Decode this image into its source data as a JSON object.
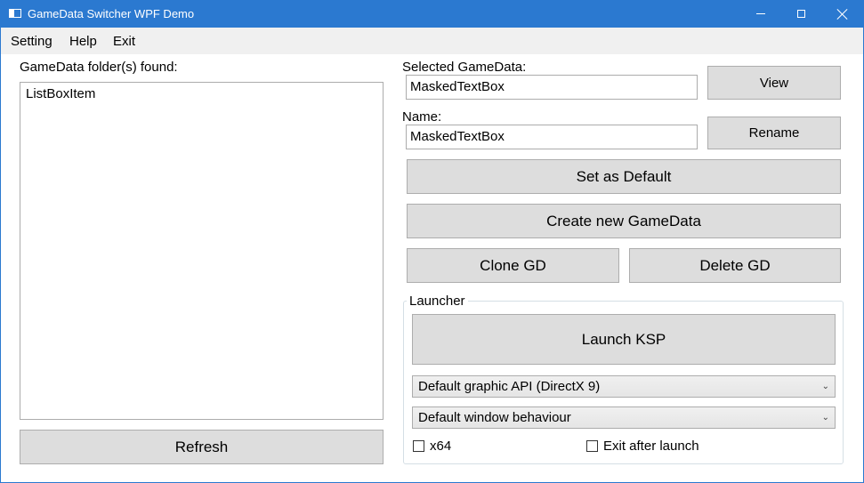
{
  "window": {
    "title": "GameData Switcher WPF Demo"
  },
  "menu": {
    "items": [
      "Setting",
      "Help",
      "Exit"
    ]
  },
  "left": {
    "folders_label": "GameData folder(s) found:",
    "list_items": [
      "ListBoxItem"
    ],
    "refresh_label": "Refresh"
  },
  "right": {
    "selected_label": "Selected GameData:",
    "selected_value": "MaskedTextBox",
    "view_label": "View",
    "name_label": "Name:",
    "name_value": "MaskedTextBox",
    "rename_label": "Rename",
    "set_default_label": "Set as Default",
    "create_label": "Create new GameData",
    "clone_label": "Clone GD",
    "delete_label": "Delete GD"
  },
  "launcher": {
    "group_label": "Launcher",
    "launch_label": "Launch KSP",
    "graphic_api_selected": "Default graphic API (DirectX 9)",
    "window_behaviour_selected": "Default window behaviour",
    "x64_label": "x64",
    "x64_checked": false,
    "exit_after_label": "Exit after launch",
    "exit_after_checked": false
  }
}
